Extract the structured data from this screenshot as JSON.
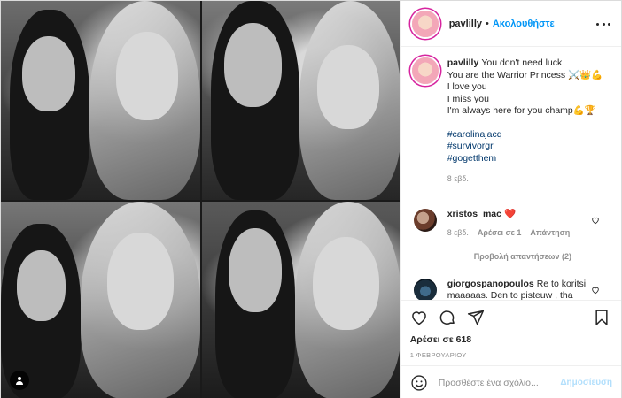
{
  "post": {
    "username": "pavlilly",
    "dot": "•",
    "follow_label": "Ακολουθήστε"
  },
  "caption": {
    "username": "pavlilly",
    "lines": [
      "You don't need luck",
      "You are the Warrior Princess ",
      "I love you",
      "I miss you",
      "I'm always here for you champ"
    ],
    "hashtags": [
      "#carolinajacq",
      "#survivorgr",
      "#gogetthem"
    ],
    "time_ago": "8 εβδ."
  },
  "comments": [
    {
      "username": "xristos_mac",
      "text": "❤️",
      "time_ago": "8 εβδ.",
      "likes": "Αρέσει σε 1",
      "reply": "Απάντηση",
      "view_replies": "Προβολή απαντήσεων (2)"
    },
    {
      "username": "giorgospanopoulos",
      "text": "Re to koritsi maaaaas. Den to pisteuw , tha"
    }
  ],
  "actions": {
    "likes_label": "Αρέσει σε 618",
    "date": "1 ΦΕΒΡΟΥΑΡΙΟΥ"
  },
  "add_comment": {
    "placeholder": "Προσθέστε ένα σχόλιο...",
    "post_label": "Δημοσίευση"
  },
  "colors": {
    "accent": "#0095f6",
    "post_disabled": "#b2dffc",
    "muted": "#8e8e8e",
    "text": "#262626"
  },
  "icons": [
    "user-tag-icon",
    "more-options-icon",
    "heart-icon",
    "comment-icon",
    "share-icon",
    "bookmark-icon",
    "emoji-icon"
  ]
}
